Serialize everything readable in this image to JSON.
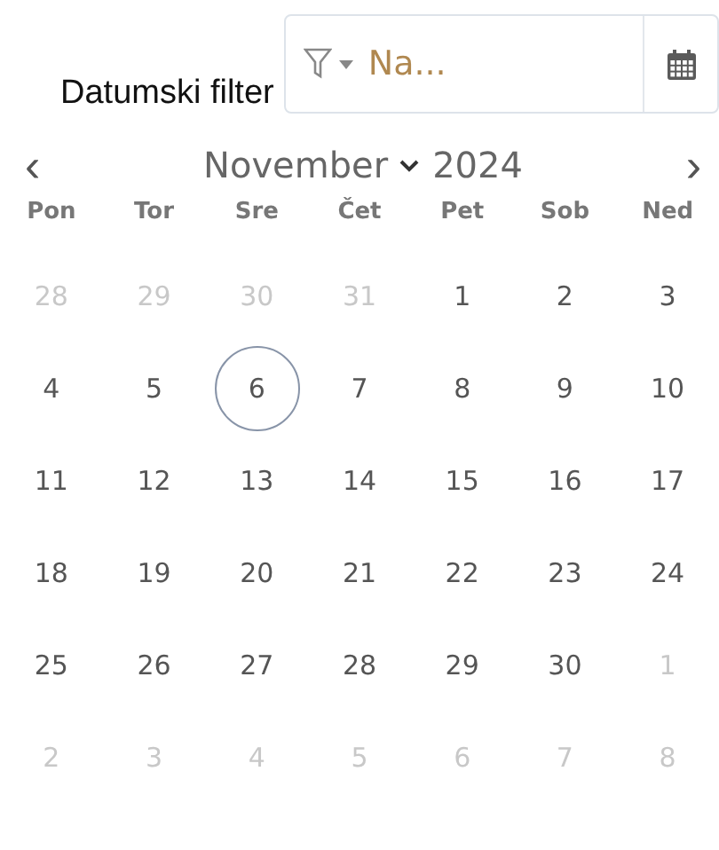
{
  "filter": {
    "label": "Datumski filter",
    "field_value": "Na..."
  },
  "calendar": {
    "month": "November",
    "year": "2024",
    "prev": "‹",
    "next": "›",
    "weekdays": [
      "Pon",
      "Tor",
      "Sre",
      "Čet",
      "Pet",
      "Sob",
      "Ned"
    ],
    "weeks": [
      [
        {
          "day": "28",
          "outside": true,
          "selected": false
        },
        {
          "day": "29",
          "outside": true,
          "selected": false
        },
        {
          "day": "30",
          "outside": true,
          "selected": false
        },
        {
          "day": "31",
          "outside": true,
          "selected": false
        },
        {
          "day": "1",
          "outside": false,
          "selected": false
        },
        {
          "day": "2",
          "outside": false,
          "selected": false
        },
        {
          "day": "3",
          "outside": false,
          "selected": false
        }
      ],
      [
        {
          "day": "4",
          "outside": false,
          "selected": false
        },
        {
          "day": "5",
          "outside": false,
          "selected": false
        },
        {
          "day": "6",
          "outside": false,
          "selected": true
        },
        {
          "day": "7",
          "outside": false,
          "selected": false
        },
        {
          "day": "8",
          "outside": false,
          "selected": false
        },
        {
          "day": "9",
          "outside": false,
          "selected": false
        },
        {
          "day": "10",
          "outside": false,
          "selected": false
        }
      ],
      [
        {
          "day": "11",
          "outside": false,
          "selected": false
        },
        {
          "day": "12",
          "outside": false,
          "selected": false
        },
        {
          "day": "13",
          "outside": false,
          "selected": false
        },
        {
          "day": "14",
          "outside": false,
          "selected": false
        },
        {
          "day": "15",
          "outside": false,
          "selected": false
        },
        {
          "day": "16",
          "outside": false,
          "selected": false
        },
        {
          "day": "17",
          "outside": false,
          "selected": false
        }
      ],
      [
        {
          "day": "18",
          "outside": false,
          "selected": false
        },
        {
          "day": "19",
          "outside": false,
          "selected": false
        },
        {
          "day": "20",
          "outside": false,
          "selected": false
        },
        {
          "day": "21",
          "outside": false,
          "selected": false
        },
        {
          "day": "22",
          "outside": false,
          "selected": false
        },
        {
          "day": "23",
          "outside": false,
          "selected": false
        },
        {
          "day": "24",
          "outside": false,
          "selected": false
        }
      ],
      [
        {
          "day": "25",
          "outside": false,
          "selected": false
        },
        {
          "day": "26",
          "outside": false,
          "selected": false
        },
        {
          "day": "27",
          "outside": false,
          "selected": false
        },
        {
          "day": "28",
          "outside": false,
          "selected": false
        },
        {
          "day": "29",
          "outside": false,
          "selected": false
        },
        {
          "day": "30",
          "outside": false,
          "selected": false
        },
        {
          "day": "1",
          "outside": true,
          "selected": false
        }
      ],
      [
        {
          "day": "2",
          "outside": true,
          "selected": false
        },
        {
          "day": "3",
          "outside": true,
          "selected": false
        },
        {
          "day": "4",
          "outside": true,
          "selected": false
        },
        {
          "day": "5",
          "outside": true,
          "selected": false
        },
        {
          "day": "6",
          "outside": true,
          "selected": false
        },
        {
          "day": "7",
          "outside": true,
          "selected": false
        },
        {
          "day": "8",
          "outside": true,
          "selected": false
        }
      ]
    ]
  }
}
